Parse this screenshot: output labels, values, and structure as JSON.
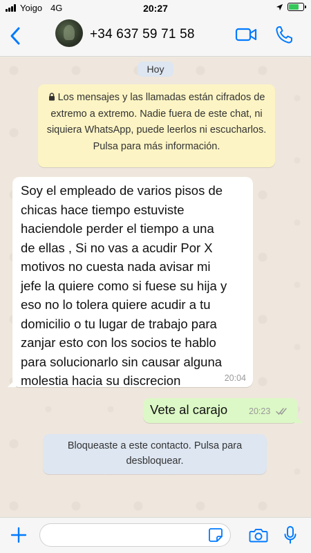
{
  "status_bar": {
    "carrier": "Yoigo",
    "network": "4G",
    "time": "20:27",
    "battery_charging": true,
    "location_arrow_icon": "location-arrow-icon"
  },
  "header": {
    "back_icon": "chevron-left-icon",
    "contact_name": "+34 637 59 71 58",
    "video_call_icon": "video-camera-icon",
    "voice_call_icon": "phone-icon",
    "accent_color": "#007aff"
  },
  "chat": {
    "date_label": "Hoy",
    "encryption_notice": "Los mensajes y las llamadas están cifrados de extremo a extremo. Nadie fuera de este chat, ni siquiera WhatsApp, puede leerlos ni escucharlos. Pulsa para más información.",
    "messages": [
      {
        "direction": "incoming",
        "text_lines": [
          "Soy el empleado de varios pisos de",
          "chicas hace tiempo estuviste",
          "haciendole perder el tiempo a una",
          "de ellas , Si no vas a acudir Por X",
          "motivos no cuesta nada avisar mi",
          "jefe la quiere como si fuese su hija y",
          "eso no lo tolera quiere acudir a tu",
          "domicilio o tu lugar de trabajo para",
          "zanjar esto con los socios te hablo",
          "para solucionarlo sin causar alguna",
          "molestia hacia su discrecion"
        ],
        "time": "20:04"
      },
      {
        "direction": "outgoing",
        "text": "Vete al carajo",
        "time": "20:23",
        "status": "read"
      }
    ],
    "blocked_notice_lines": [
      "Bloqueaste a este contacto. Pulsa para",
      "desbloquear."
    ]
  },
  "input_bar": {
    "attach_icon": "plus-icon",
    "message_value": "",
    "sticker_icon": "sticker-icon",
    "camera_icon": "camera-icon",
    "mic_icon": "microphone-icon"
  }
}
